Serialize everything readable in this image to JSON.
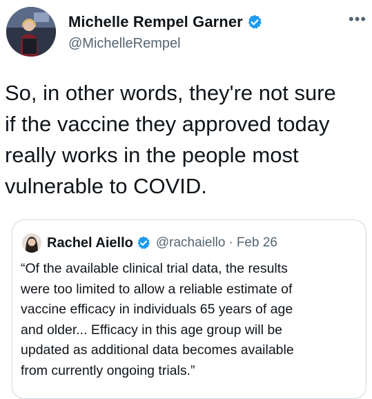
{
  "author": {
    "display_name": "Michelle Rempel Garner",
    "handle": "@MichelleRempel",
    "verified": true,
    "avatar": "profile-photo"
  },
  "more_icon": "more-options-icon",
  "tweet": {
    "text": "So, in other words, they're not sure\nif the vaccine they approved today\nreally works in the people most\nvulnerable to COVID."
  },
  "quoted_tweet": {
    "display_name": "Rachel Aiello",
    "handle": "@rachaiello",
    "separator": "·",
    "date": "Feb 26",
    "verified": true,
    "text": "“Of the available clinical trial data, the results\nwere too limited to allow a reliable estimate of\nvaccine efficacy in individuals 65 years of age\nand older... Efficacy in this age group will be\nupdated as additional data becomes available\nfrom currently ongoing trials.”"
  },
  "colors": {
    "verified_blue": "#1d9bf0",
    "secondary_text": "#536471",
    "border": "#cfd9de",
    "text": "#0f1419"
  }
}
